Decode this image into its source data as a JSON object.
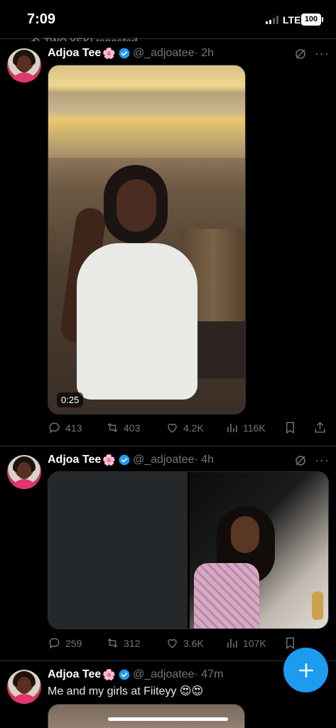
{
  "status_bar": {
    "time": "7:09",
    "network": "LTE",
    "battery": "100"
  },
  "repost_banner": {
    "text": "TWO YEKI reposted"
  },
  "tweets": [
    {
      "author_name": "Adjoa Tee",
      "emoji": "🌸",
      "handle": "@_adjoatee",
      "time": "· 2h",
      "text": "",
      "video_duration": "0:25",
      "replies": "413",
      "reposts": "403",
      "likes": "4.2K",
      "views": "116K"
    },
    {
      "author_name": "Adjoa Tee",
      "emoji": "🌸",
      "handle": "@_adjoatee",
      "time": "· 4h",
      "text": "",
      "replies": "259",
      "reposts": "312",
      "likes": "3.6K",
      "views": "107K"
    },
    {
      "author_name": "Adjoa Tee",
      "emoji": "🌸",
      "handle": "@_adjoatee",
      "time": "· 47m",
      "text": "Me and my girls at Fiiteyy 😍😍"
    }
  ],
  "colors": {
    "accent": "#1d9bf0",
    "muted": "#71767b",
    "background": "#000000"
  },
  "icons": [
    "reply-icon",
    "repost-icon",
    "like-icon",
    "views-icon",
    "bookmark-icon",
    "share-icon",
    "grok-icon",
    "more-icon",
    "verified-badge-icon",
    "compose-icon"
  ]
}
